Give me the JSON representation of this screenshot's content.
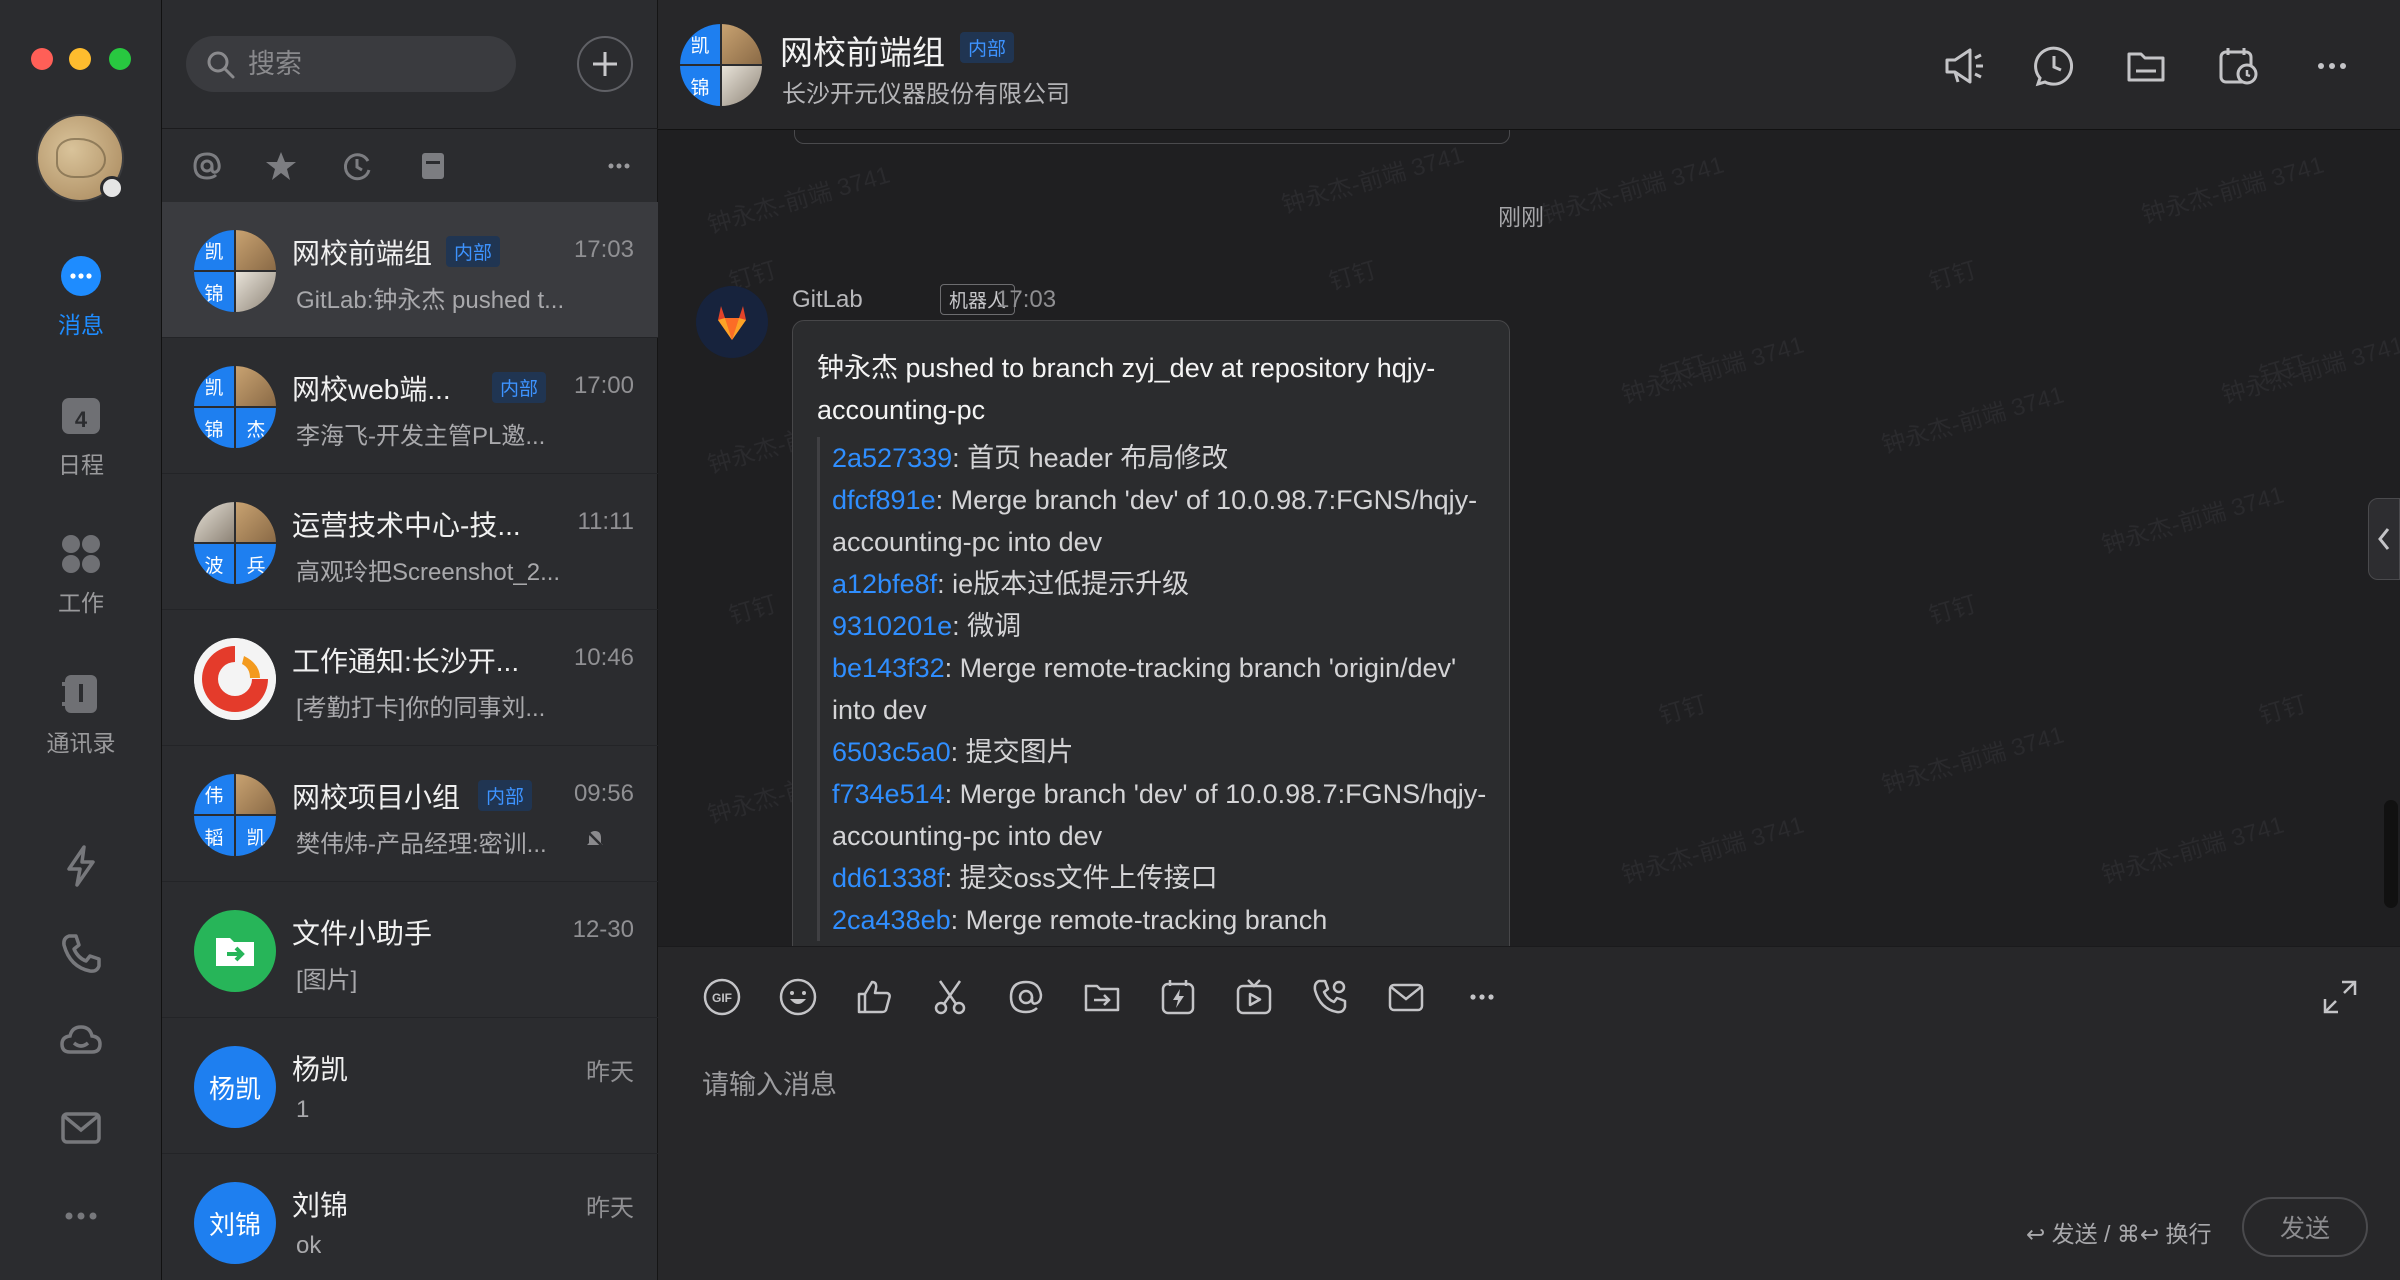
{
  "window": {
    "title": "网校前端组"
  },
  "nav": {
    "items": [
      {
        "label": "消息",
        "icon": "message-icon",
        "active": true
      },
      {
        "label": "日程",
        "icon": "calendar-icon",
        "badge": "4"
      },
      {
        "label": "工作",
        "icon": "apps-grid-icon"
      },
      {
        "label": "通讯录",
        "icon": "contacts-icon"
      }
    ],
    "extra_icons": [
      "lightning-icon",
      "phone-icon",
      "cloud-drive-icon",
      "mail-icon",
      "more-icon"
    ]
  },
  "search": {
    "placeholder": "搜索"
  },
  "conversations": [
    {
      "name": "网校前端组",
      "tag": "内部",
      "time": "17:03",
      "preview": "GitLab:钟永杰 pushed t...",
      "avatar": [
        "凯",
        "",
        "锦",
        ""
      ],
      "active": true
    },
    {
      "name": "网校web端...",
      "tag": "内部",
      "time": "17:00",
      "preview": "李海飞-开发主管PL邀...",
      "avatar": [
        "凯",
        "",
        "锦",
        "杰"
      ]
    },
    {
      "name": "运营技术中心-技...",
      "tag": "",
      "time": "11:11",
      "preview": "高观玲把Screenshot_2...",
      "avatar": [
        "",
        "",
        "波",
        "兵"
      ]
    },
    {
      "name": "工作通知:长沙开...",
      "tag": "",
      "time": "10:46",
      "preview": "[考勤打卡]你的同事刘..."
    },
    {
      "name": "网校项目小组",
      "tag": "内部",
      "time": "09:56",
      "preview": "樊伟炜-产品经理:密训...",
      "avatar": [
        "伟",
        "",
        "韬",
        "凯"
      ],
      "muted": true
    },
    {
      "name": "文件小助手",
      "tag": "",
      "time": "12-30",
      "preview": "[图片]"
    },
    {
      "name": "杨凯",
      "tag": "",
      "time": "昨天",
      "preview": "1",
      "avatar_text": "杨凯"
    },
    {
      "name": "刘锦",
      "tag": "",
      "time": "昨天",
      "preview": "ok",
      "avatar_text": "刘锦"
    }
  ],
  "chat": {
    "title": "网校前端组",
    "tag": "内部",
    "subtitle": "长沙开元仪器股份有限公司",
    "avatar": [
      "凯",
      "",
      "锦",
      ""
    ],
    "time_divider": "刚刚",
    "watermark_name": "钟永杰-前端 3741",
    "watermark_brand": "钉钉",
    "message": {
      "sender": "GitLab",
      "badge": "机器人",
      "time": "17:03",
      "title": "钟永杰 pushed to branch zyj_dev at repository hqjy-accounting-pc",
      "commits": [
        {
          "hash": "2a527339",
          "text": ": 首页 header 布局修改"
        },
        {
          "hash": "dfcf891e",
          "text": ": Merge branch 'dev' of 10.0.98.7:FGNS/hqjy-accounting-pc into dev"
        },
        {
          "hash": "a12bfe8f",
          "text": ": ie版本过低提示升级"
        },
        {
          "hash": "9310201e",
          "text": ": 微调"
        },
        {
          "hash": "be143f32",
          "text": ": Merge remote-tracking branch 'origin/dev' into dev"
        },
        {
          "hash": "6503c5a0",
          "text": ": 提交图片"
        },
        {
          "hash": "f734e514",
          "text": ": Merge branch 'dev' of 10.0.98.7:FGNS/hqjy-accounting-pc into dev"
        },
        {
          "hash": "dd61338f",
          "text": ": 提交oss文件上传接口"
        },
        {
          "hash": "2ca438eb",
          "text": ": Merge remote-tracking branch"
        }
      ]
    },
    "composer": {
      "placeholder": "请输入消息",
      "send_hint": "↩ 发送 / ⌘↩ 换行",
      "send_label": "发送",
      "tools": [
        "gif-icon",
        "emoji-icon",
        "thumbs-up-icon",
        "scissors-icon",
        "at-icon",
        "file-send-icon",
        "ding-icon",
        "video-icon",
        "phone-call-icon",
        "mail-icon",
        "more-icon"
      ]
    }
  },
  "colors": {
    "accent": "#1e8cff",
    "background": "#1f1f21",
    "panel": "#2b2c2f"
  }
}
